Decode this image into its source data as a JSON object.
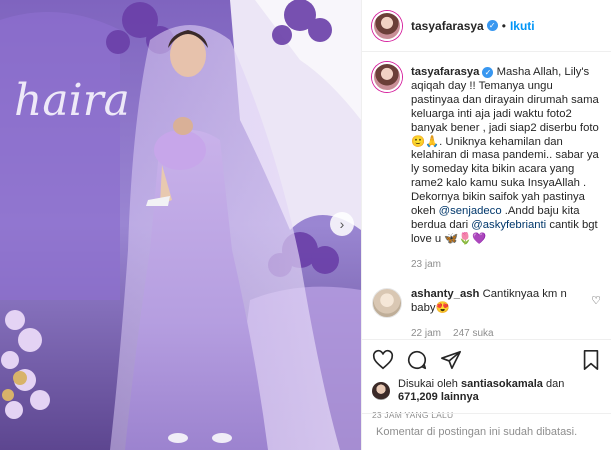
{
  "photo": {
    "backdrop_text": "haira"
  },
  "header": {
    "username": "tasyafarasya",
    "separator": "•",
    "follow_label": "Ikuti"
  },
  "caption": {
    "username": "tasyafarasya",
    "text_1": " Masha Allah, Lily's aqiqah day !! Temanya ungu pastinyaa dan dirayain dirumah sama keluarga inti aja jadi waktu foto2 banyak bener , jadi siap2 diserbu foto 🙂🙏. Uniknya kehamilan dan kelahiran di masa pandemi.. sabar ya ly someday kita bikin acara yang rame2 kalo kamu suka InsyaAllah . Dekornya bikin saifok yah pastinya okeh ",
    "mention_1": "@senjadeco",
    "text_2": " .Andd baju kita berdua dari ",
    "mention_2": "@askyfebrianti",
    "text_3": " cantik bgt love u 🦋🌷💜",
    "time": "23 jam"
  },
  "reply": {
    "username": "ashanty_ash",
    "text": " Cantiknyaa km n baby😍",
    "time": "22 jam",
    "likes": "247 suka"
  },
  "likes": {
    "prefix": "Disukai oleh ",
    "user": "santiasokamala",
    "middle": " dan ",
    "count": "671,209",
    "suffix": " lainnya"
  },
  "timestamp": "23 JAM YANG LALU",
  "footer": {
    "comments_disabled": "Komentar di postingan ini sudah dibatasi."
  },
  "colors": {
    "link": "#0095f6",
    "verified": "#3897f0",
    "muted": "#8e8e8e"
  },
  "icons": [
    "heart-icon",
    "comment-icon",
    "share-icon",
    "bookmark-icon",
    "verified-icon",
    "chevron-right-icon"
  ]
}
